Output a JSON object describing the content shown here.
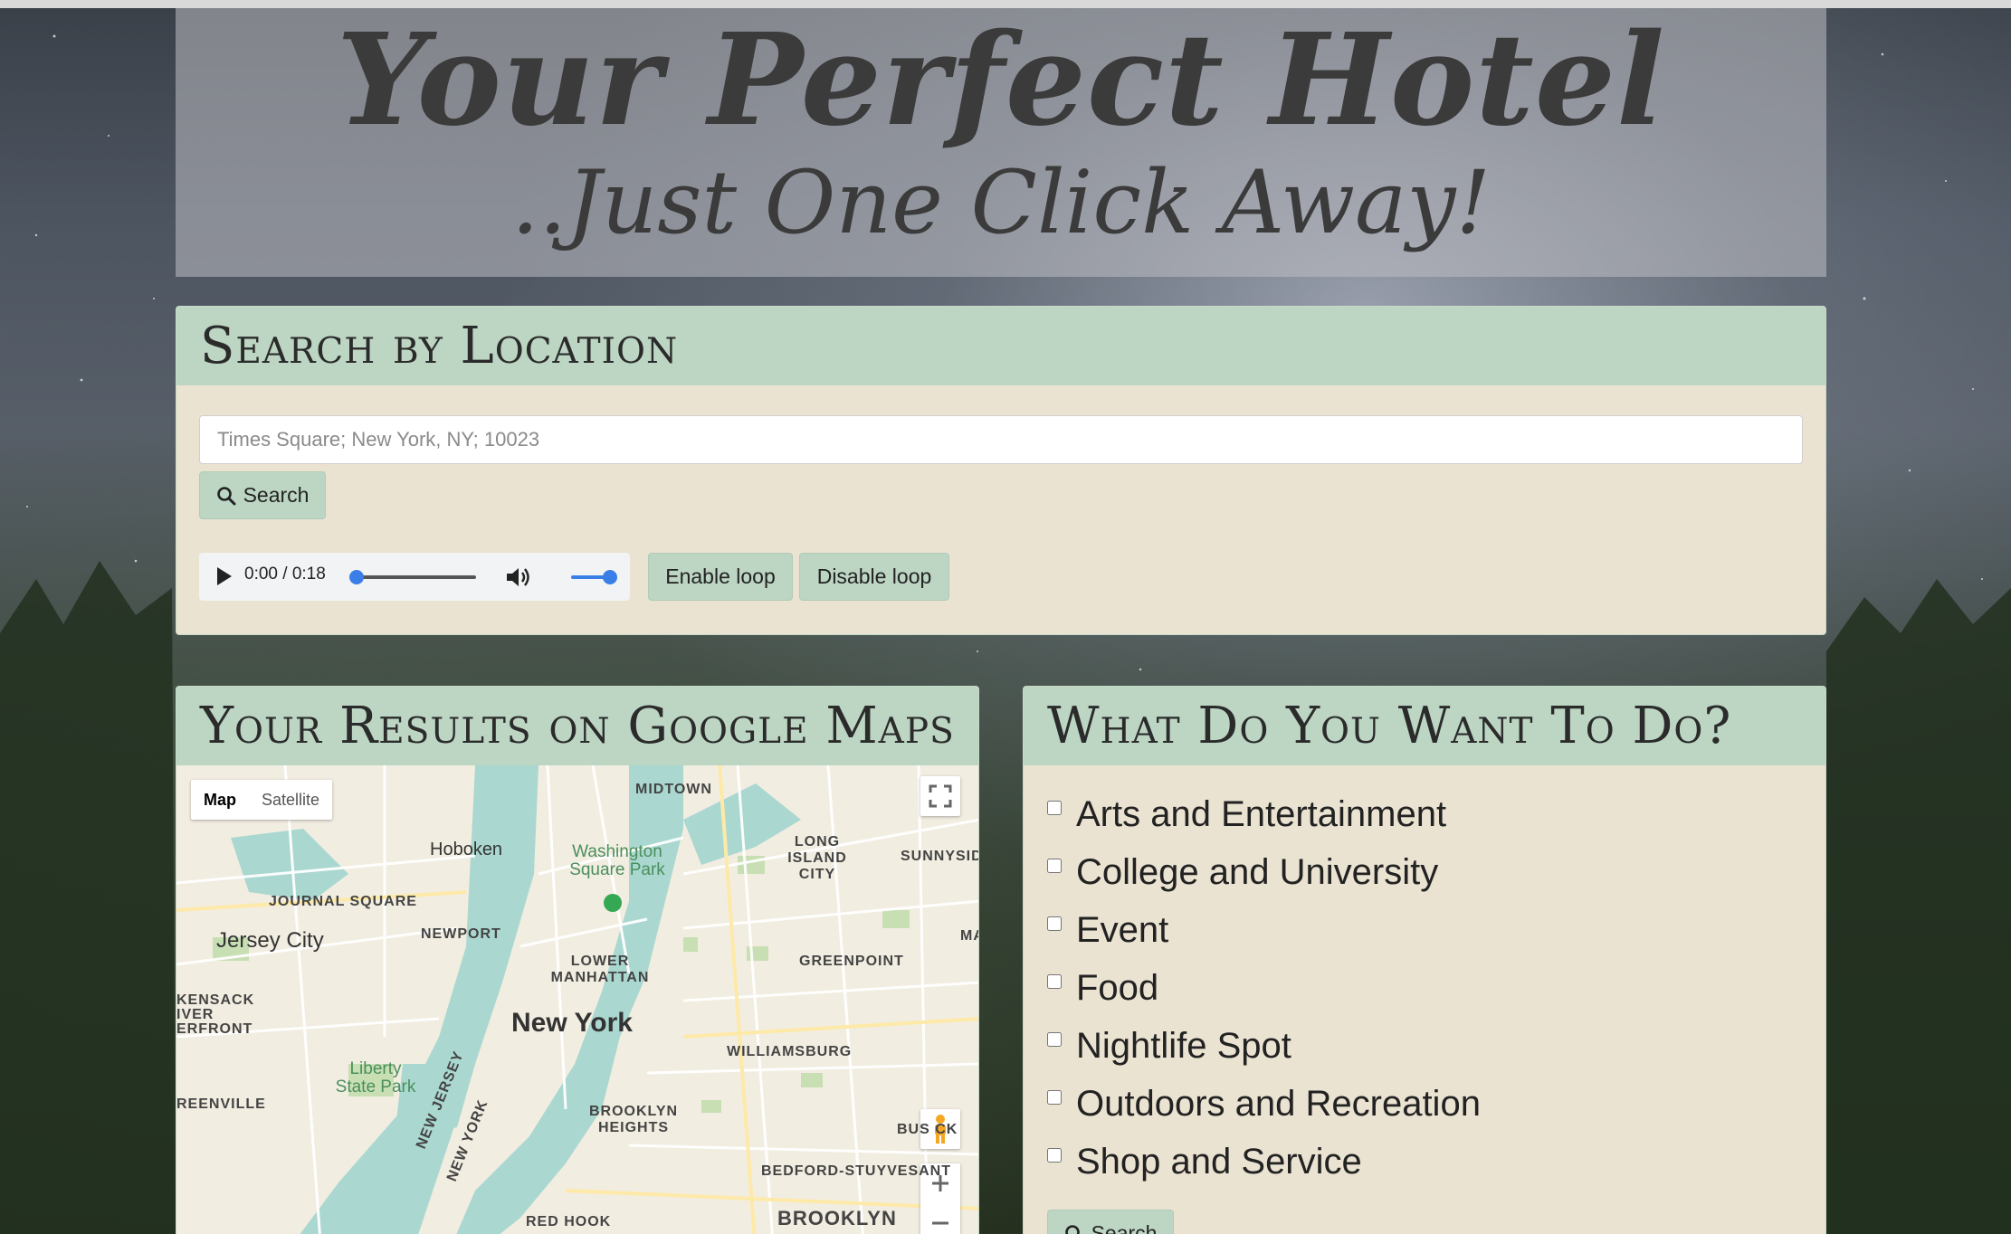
{
  "hero": {
    "title": "Your Perfect Hotel",
    "subtitle": "..Just One Click Away!"
  },
  "search_section": {
    "heading": "Search by Location",
    "input_placeholder": "Times Square; New York, NY; 10023",
    "search_label": "Search",
    "audio_time": "0:00 / 0:18",
    "audio_progress": 0,
    "audio_volume": 1,
    "enable_loop_label": "Enable loop",
    "disable_loop_label": "Disable loop"
  },
  "map_section": {
    "heading": "Your Results on Google Maps",
    "map_type_options": [
      "Map",
      "Satellite"
    ],
    "selected_map_type": "Map",
    "labels": {
      "midtown": "MIDTOWN",
      "hoboken": "Hoboken",
      "washington_square": "Washington Square Park",
      "long_island_city": "LONG ISLAND CITY",
      "sunnyside": "SUNNYSID",
      "journal_square": "JOURNAL SQUARE",
      "jersey_city": "Jersey City",
      "newport": "NEWPORT",
      "lower_manhattan": "LOWER MANHATTAN",
      "greenpoint": "GREENPOINT",
      "hackensack": "KENSACK IVER ERFRONT",
      "new_york": "New York",
      "williamsburg": "WILLIAMSBURG",
      "liberty_state_park": "Liberty State Park",
      "greenville": "REENVILLE",
      "new_jersey": "NEW JERSEY",
      "new_york_state": "NEW YORK",
      "brooklyn_heights": "BROOKLYN HEIGHTS",
      "bushwick": "BUS  CK",
      "bedford": "BEDFORD-STUYVESANT",
      "red_hook": "RED HOOK",
      "brooklyn": "BROOKLYN",
      "ma": "MA"
    }
  },
  "todo_section": {
    "heading": "What Do You Want To Do?",
    "categories": [
      "Arts and Entertainment",
      "College and University",
      "Event",
      "Food",
      "Nightlife Spot",
      "Outdoors and Recreation",
      "Shop and Service"
    ],
    "search_label": "Search"
  },
  "colors": {
    "panel_header": "#bcd6c3",
    "panel_body": "#ebe3d2",
    "accent_blue": "#3a7ee8"
  }
}
